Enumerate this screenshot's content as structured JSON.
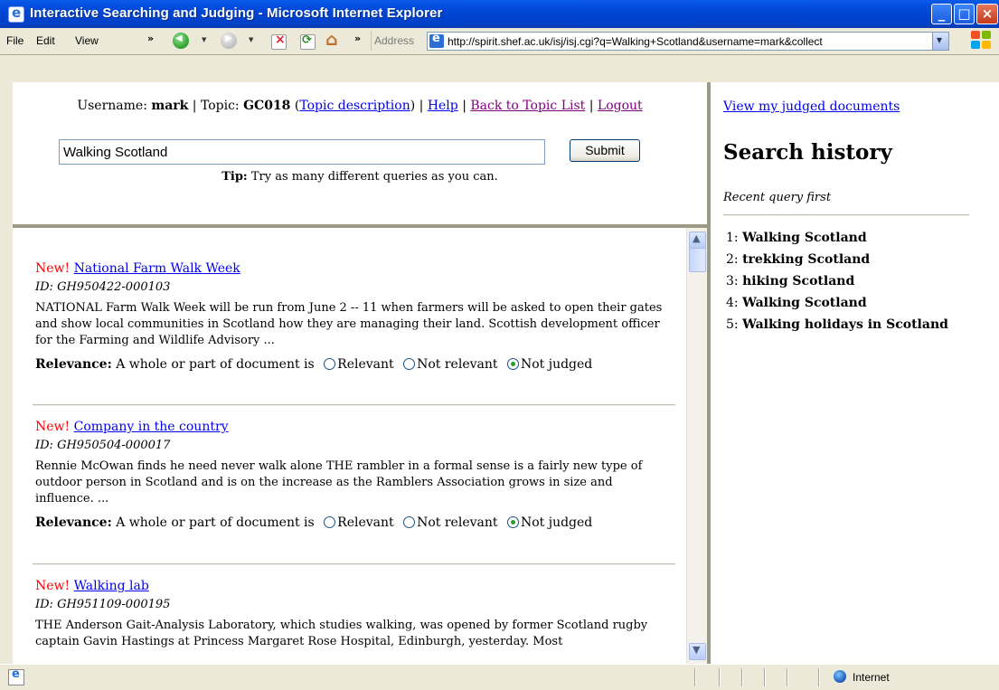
{
  "window": {
    "title": "Interactive Searching and Judging - Microsoft Internet Explorer",
    "min_glyph": "_",
    "max_glyph": "□",
    "close_glyph": "×"
  },
  "menu": {
    "file": "File",
    "edit": "Edit",
    "view": "View"
  },
  "toolbar": {
    "chevron": "»",
    "address_label": "Address",
    "address_url": "http://spirit.shef.ac.uk/isj/isj.cgi?q=Walking+Scotland&username=mark&collect"
  },
  "header": {
    "username_label": "Username:",
    "username": "mark",
    "topic_label": "| Topic:",
    "topic": "GC018",
    "topic_description_link": "Topic description",
    "help_link": "Help",
    "back_link": "Back to Topic List",
    "logout_link": "Logout",
    "pipe": "|",
    "open_paren": "(",
    "close_paren": ")"
  },
  "search": {
    "query_value": "Walking Scotland",
    "submit_label": "Submit",
    "tip_label": "Tip:",
    "tip_text": "Try as many different queries as you can."
  },
  "results": [
    {
      "new_label": "New!",
      "title": "National Farm Walk Week",
      "id": "ID: GH950422-000103",
      "snippet": "NATIONAL Farm Walk Week will be run from June 2 -- 11 when farmers will be asked to open their gates and show local communities in Scotland how they are managing their land. Scottish development officer for the Farming and Wildlife Advisory ...",
      "relevance_label": "Relevance:",
      "relevance_prompt": "A whole or part of document is",
      "options": [
        "Relevant",
        "Not relevant",
        "Not judged"
      ],
      "selected": "Not judged"
    },
    {
      "new_label": "New!",
      "title": "Company in the country",
      "id": "ID: GH950504-000017",
      "snippet": "Rennie McOwan finds he need never walk alone THE rambler in a formal sense is a fairly new type of outdoor person in Scotland and is on the increase as the Ramblers Association grows in size and influence. ...",
      "relevance_label": "Relevance:",
      "relevance_prompt": "A whole or part of document is",
      "options": [
        "Relevant",
        "Not relevant",
        "Not judged"
      ],
      "selected": "Not judged"
    },
    {
      "new_label": "New!",
      "title": "Walking lab",
      "id": "ID: GH951109-000195",
      "snippet": "THE Anderson Gait-Analysis Laboratory, which studies walking, was opened by former Scotland rugby captain Gavin Hastings at Princess Margaret Rose Hospital, Edinburgh, yesterday. Most"
    }
  ],
  "sidebar": {
    "judged_link": "View my judged documents",
    "history_title": "Search history",
    "history_subtitle": "Recent query first",
    "history": [
      {
        "num": "1:",
        "query": "Walking Scotland"
      },
      {
        "num": "2:",
        "query": "trekking Scotland"
      },
      {
        "num": "3:",
        "query": "hiking Scotland"
      },
      {
        "num": "4:",
        "query": "Walking Scotland"
      },
      {
        "num": "5:",
        "query": "Walking holidays in Scotland"
      }
    ]
  },
  "status": {
    "zone": "Internet"
  }
}
